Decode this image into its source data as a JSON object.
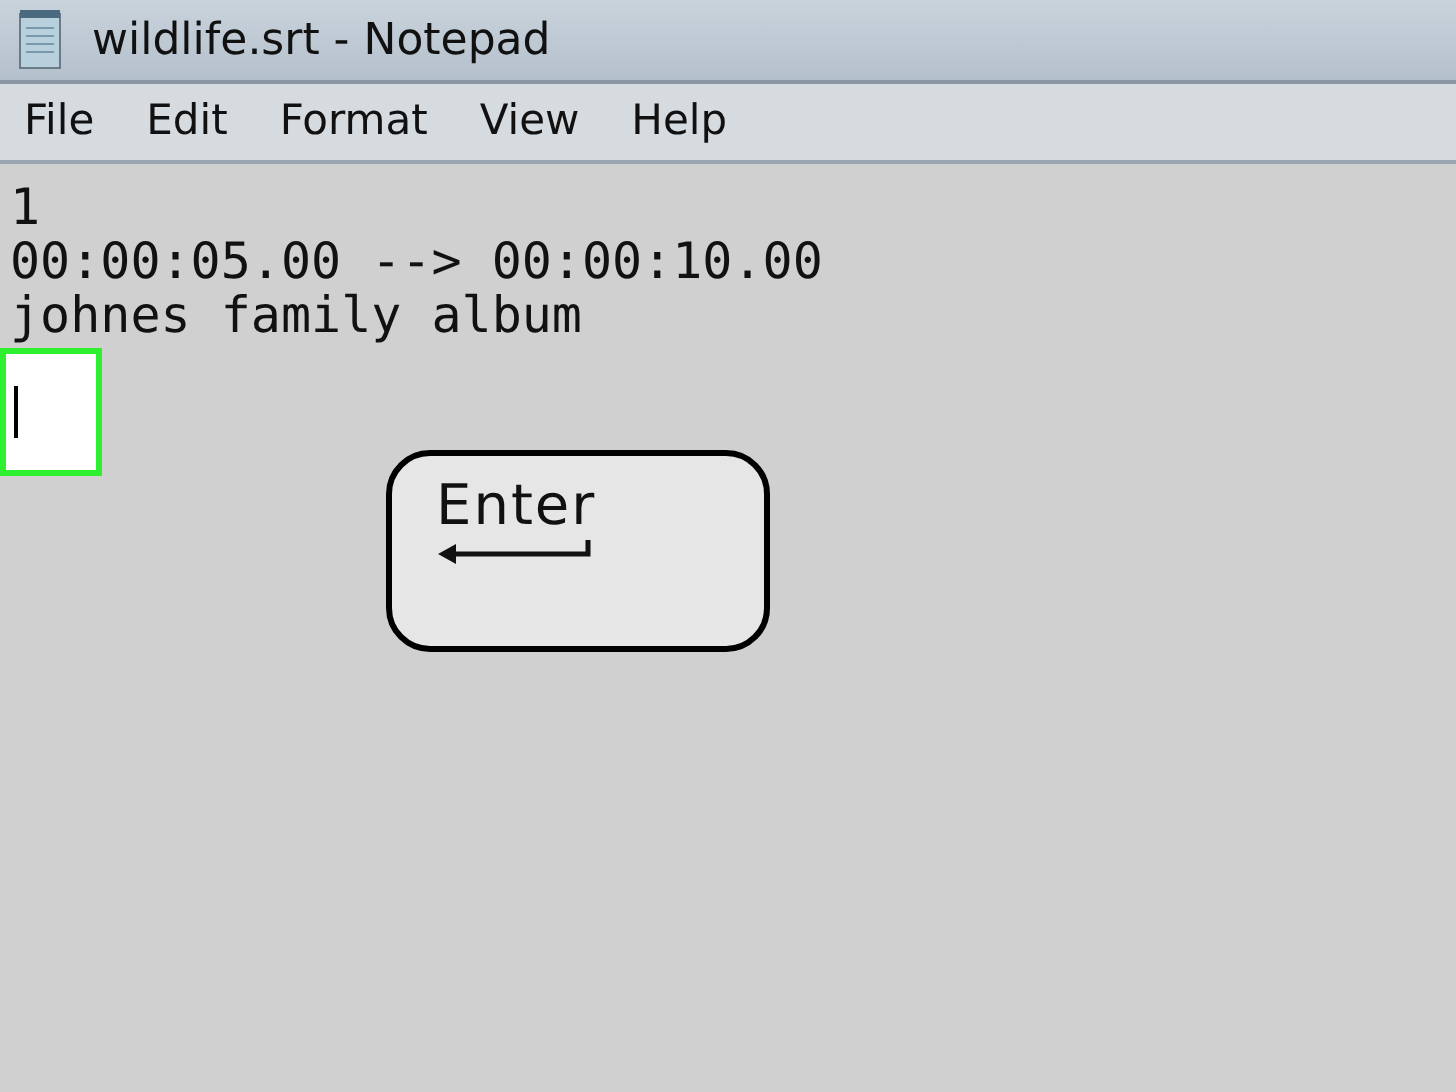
{
  "window": {
    "title": "wildlife.srt - Notepad"
  },
  "menu": [
    "File",
    "Edit",
    "Format",
    "View",
    "Help"
  ],
  "document": {
    "lines": [
      "1",
      "00:00:05.00 --> 00:00:10.00",
      "johnes family album"
    ],
    "caret_highlighted": true
  },
  "key_overlay": {
    "label": "Enter"
  }
}
